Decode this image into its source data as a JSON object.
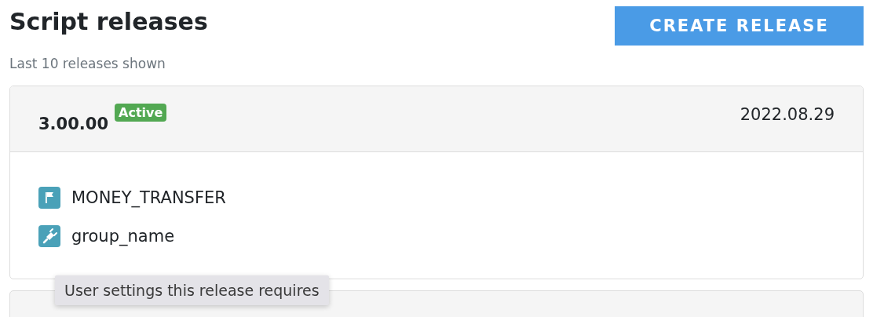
{
  "page": {
    "title": "Script releases",
    "subtitle": "Last 10 releases shown",
    "create_button": "CREATE RELEASE"
  },
  "releases": [
    {
      "version": "3.00.00",
      "status": "Active",
      "date": "2022.08.29",
      "items": [
        {
          "kind": "flag",
          "label": "MONEY_TRANSFER"
        },
        {
          "kind": "plug",
          "label": "group_name"
        }
      ]
    }
  ],
  "tooltip": "User settings this release requires"
}
